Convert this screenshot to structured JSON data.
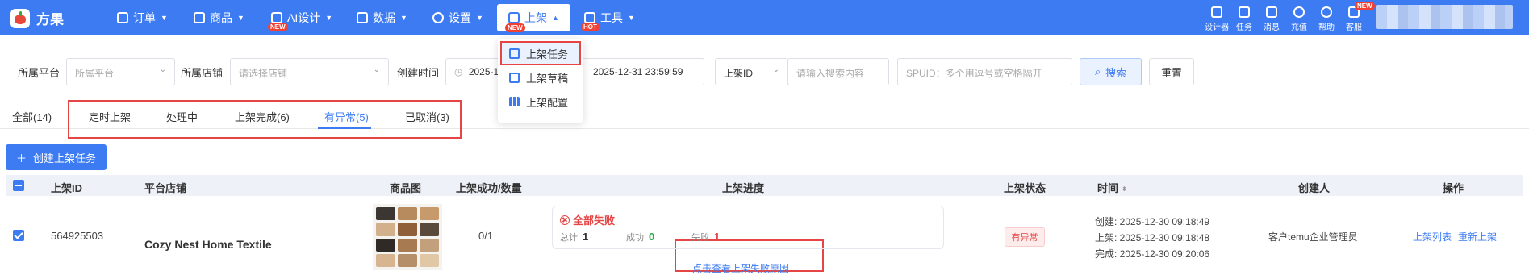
{
  "brand": {
    "name": "方果"
  },
  "nav": {
    "items": [
      {
        "label": "订单",
        "icon": "order-icon",
        "badge": ""
      },
      {
        "label": "商品",
        "icon": "product-icon",
        "badge": ""
      },
      {
        "label": "AI设计",
        "icon": "ai-icon",
        "badge": "NEW"
      },
      {
        "label": "数据",
        "icon": "data-icon",
        "badge": ""
      },
      {
        "label": "设置",
        "icon": "gear-icon",
        "badge": ""
      },
      {
        "label": "上架",
        "icon": "listing-icon",
        "badge": "NEW"
      },
      {
        "label": "工具",
        "icon": "tool-icon",
        "badge": "HOT"
      }
    ],
    "right_icons": [
      {
        "label": "设计器",
        "icon": "designer-icon"
      },
      {
        "label": "任务",
        "icon": "task-icon"
      },
      {
        "label": "消息",
        "icon": "message-icon"
      },
      {
        "label": "充值",
        "icon": "recharge-icon"
      },
      {
        "label": "帮助",
        "icon": "help-icon"
      },
      {
        "label": "客服",
        "icon": "service-icon",
        "badge": "NEW"
      }
    ]
  },
  "dropdown": {
    "items": [
      "上架任务",
      "上架草稿",
      "上架配置"
    ]
  },
  "filters": {
    "platform_label": "所属平台",
    "platform_placeholder": "所属平台",
    "shop_label": "所属店铺",
    "shop_placeholder": "请选择店铺",
    "time_label": "创建时间",
    "time_start": "2025-12",
    "time_end": "2025-12-31 23:59:59",
    "id_type": "上架ID",
    "search_placeholder": "请输入搜索内容",
    "spuid_placeholder": "SPUID：多个用逗号或空格隔开",
    "search_button": "搜索",
    "reset_button": "重置"
  },
  "tabs": [
    {
      "label": "全部(14)"
    },
    {
      "label": "定时上架"
    },
    {
      "label": "处理中"
    },
    {
      "label": "上架完成(6)"
    },
    {
      "label": "有异常(5)"
    },
    {
      "label": "已取消(3)"
    }
  ],
  "create_button": "创建上架任务",
  "table": {
    "headers": [
      "上架ID",
      "平台店铺",
      "商品图",
      "上架成功/数量",
      "上架进度",
      "上架状态",
      "时间",
      "创建人",
      "操作"
    ],
    "row": {
      "id": "564925503",
      "shop": "Cozy Nest Home Textile",
      "success_count": "0/1",
      "progress_title": "全部失败",
      "total_label": "总计",
      "total": "1",
      "success_label": "成功",
      "success": "0",
      "fail_label": "失败",
      "fail": "1",
      "fail_link": "点击查看上架失败原因",
      "status": "有异常",
      "created": "创建: 2025-12-30 09:18:49",
      "listed": "上架: 2025-12-30 09:18:48",
      "completed": "完成: 2025-12-30 09:20:06",
      "creator": "客户temu企业管理员",
      "action_list": "上架列表",
      "action_relist": "重新上架"
    }
  },
  "colors": {
    "primary": "#3d7bf2",
    "danger": "#e64545",
    "success": "#2fa84f"
  }
}
